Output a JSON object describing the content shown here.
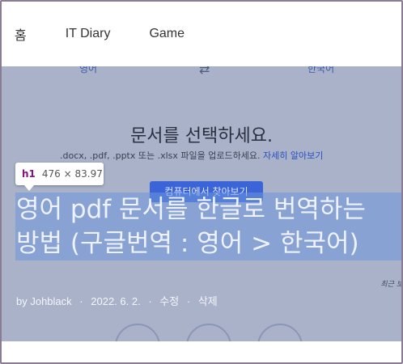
{
  "nav": {
    "items": [
      {
        "label": "홈"
      },
      {
        "label": "IT Diary"
      },
      {
        "label": "Game"
      }
    ]
  },
  "translator": {
    "source_lang": "영어",
    "swap_icon": "⇄",
    "target_lang": "한국어",
    "doc_title": "문서를 선택하세요.",
    "doc_desc": ".docx, .pdf, .pptx 또는 .xlsx 파일을 업로드하세요.",
    "doc_more": "자세히 알아보기",
    "pick_button": "컴퓨터에서 찾아보기"
  },
  "inspector": {
    "tag": "h1",
    "dims": "476 × 83.97"
  },
  "post": {
    "title_line1": "영어 pdf 문서를 한글로 번역하는",
    "title_line2": "방법 (구글번역 : 영어 > 한국어)",
    "recent_note": "최근 보",
    "author": "by Johblack",
    "date": "2022. 6. 2.",
    "edit": "수정",
    "delete": "삭제",
    "sep": "·"
  },
  "colors": {
    "highlight": "#6e96dc",
    "tag": "#881280",
    "button": "#3a64d8"
  }
}
